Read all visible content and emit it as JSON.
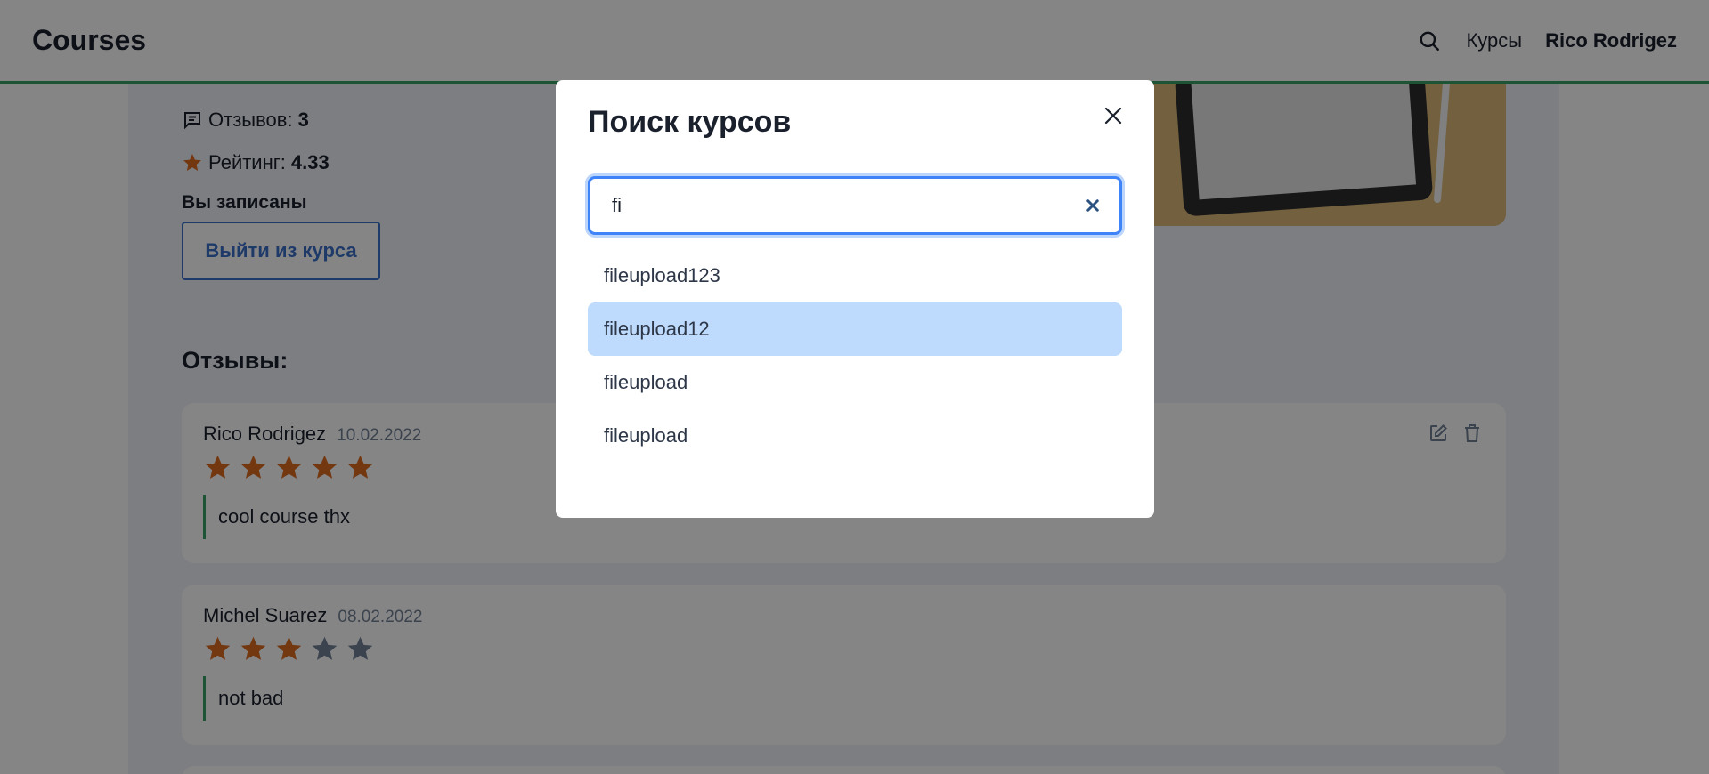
{
  "header": {
    "brand": "Courses",
    "search_icon": "search-icon",
    "nav_courses": "Курсы",
    "user_name": "Rico Rodrigez",
    "accent": "#38a169"
  },
  "course": {
    "reviews_label": "Отзывов:",
    "reviews_count": "3",
    "rating_label": "Рейтинг:",
    "rating_value": "4.33",
    "enrolled_text": "Вы записаны",
    "leave_button": "Выйти из курса"
  },
  "reviews_section": {
    "title": "Отзывы:",
    "items": [
      {
        "author": "Rico Rodrigez",
        "date": "10.02.2022",
        "rating": 5,
        "text": "cool course thx",
        "editable": true
      },
      {
        "author": "Michel Suarez",
        "date": "08.02.2022",
        "rating": 3,
        "text": "not bad",
        "editable": false
      }
    ]
  },
  "search_modal": {
    "title": "Поиск курсов",
    "query": "fi",
    "results": [
      "fileupload123",
      "fileupload12",
      "fileupload",
      "fileupload"
    ],
    "highlighted_index": 1,
    "highlight_color": "#bedbfd"
  },
  "colors": {
    "star_filled": "#dd6b20",
    "star_empty": "#718096",
    "primary": "#3b6fc9"
  }
}
